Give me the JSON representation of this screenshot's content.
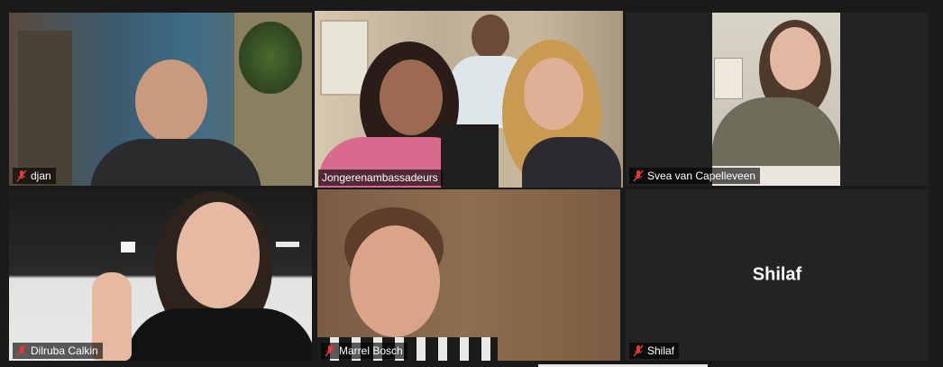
{
  "participants": [
    {
      "name": "djan",
      "muted": true
    },
    {
      "name": "Jongerenambassadeurs",
      "muted": false,
      "active_speaker": true
    },
    {
      "name": "Svea van Capelleveen",
      "muted": true
    },
    {
      "name": "Dilruba Calkin",
      "muted": true
    },
    {
      "name": "Marrel Bosch",
      "muted": true
    },
    {
      "name": "Shilaf",
      "muted": true,
      "video_off": true,
      "display_name": "Shilaf"
    }
  ],
  "icons": {
    "muted": "mic-muted-icon"
  },
  "colors": {
    "active_speaker_border": "#9bd84a",
    "muted_icon": "#e03a3a",
    "background": "#1a1a1a"
  }
}
